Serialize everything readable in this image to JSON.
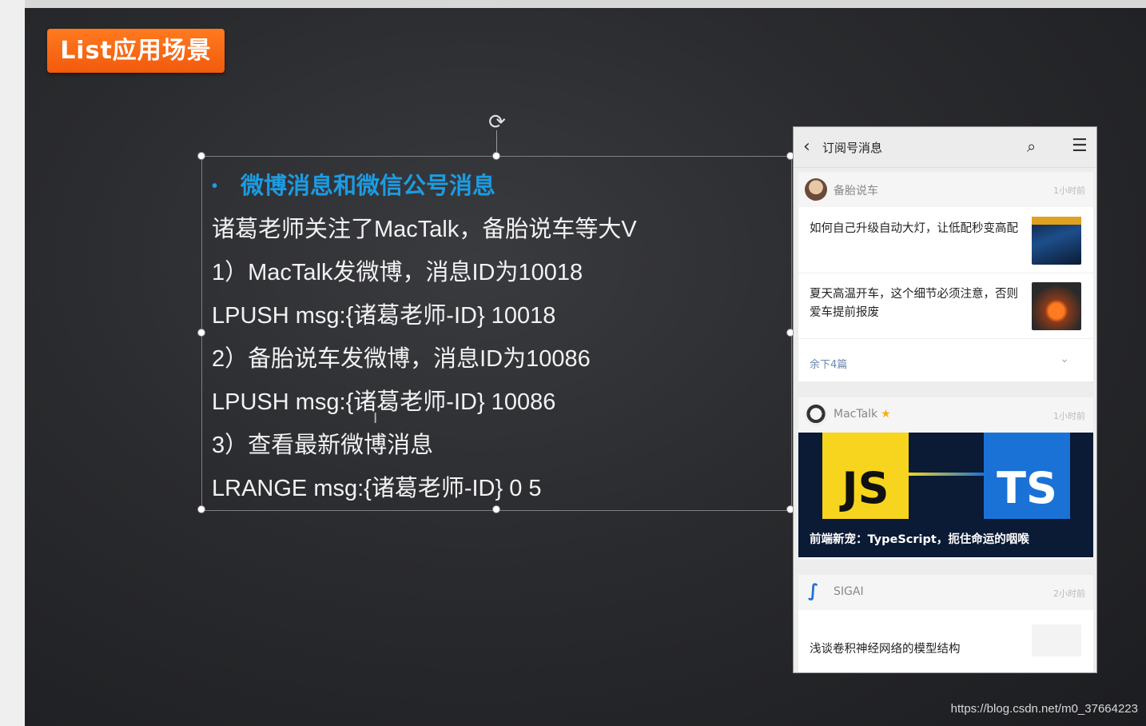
{
  "slide": {
    "title": "List应用场景",
    "lines": [
      "微博消息和微信公号消息",
      "诸葛老师关注了MacTalk，备胎说车等大V",
      "1）MacTalk发微博，消息ID为10018",
      "LPUSH  msg:{诸葛老师-ID}  10018",
      "2）备胎说车发微博，消息ID为10086",
      "LPUSH  msg:{诸葛老师-ID} 10086",
      "3）查看最新微博消息",
      "LRANGE  msg:{诸葛老师-ID}  0  5"
    ]
  },
  "phone": {
    "nav": {
      "back_icon": "‹",
      "title": "订阅号消息",
      "search_icon": "⌕",
      "menu_icon": "☰"
    },
    "accounts": [
      {
        "name": "备胎说车",
        "time": "1小时前",
        "articles": [
          {
            "title": "如何自己升级自动大灯，让低配秒变高配"
          },
          {
            "title": "夏天高温开车，这个细节必须注意，否则爱车提前报废"
          }
        ],
        "more": "余下4篇"
      },
      {
        "name": "MacTalk",
        "time": "1小时前",
        "banner": {
          "left_label": "JS",
          "right_label": "TS",
          "caption": "前端新宠：TypeScript，扼住命运的咽喉"
        }
      },
      {
        "name": "SIGAI",
        "time": "2小时前",
        "articles": [
          {
            "title": "浅谈卷积神经网络的模型结构"
          }
        ]
      }
    ]
  },
  "watermark": "https://blog.csdn.net/m0_37664223"
}
